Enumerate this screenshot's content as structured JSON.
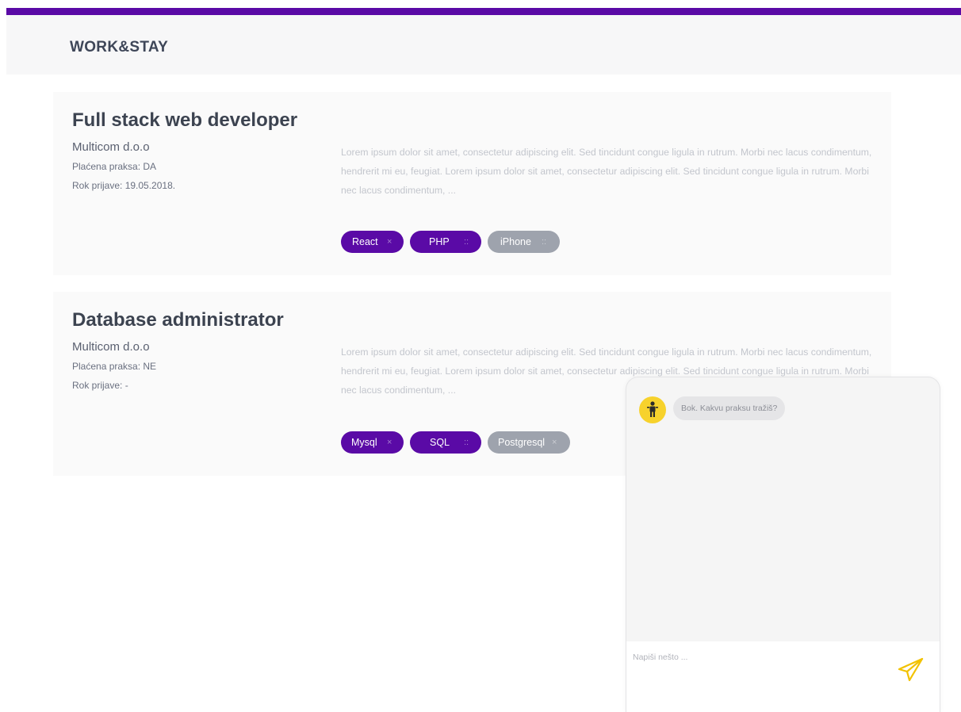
{
  "header": {
    "brand": "WORK&STAY"
  },
  "jobs": [
    {
      "title": "Full stack web developer",
      "company": "Multicom d.o.o",
      "paid": "Plaćena praksa: DA",
      "deadline": "Rok prijave: 19.05.2018.",
      "description": "Lorem ipsum dolor sit amet, consectetur adipiscing elit. Sed tincidunt congue ligula in rutrum. Morbi nec lacus condimentum, hendrerit mi eu, feugiat. Lorem ipsum dolor sit amet, consectetur adipiscing elit. Sed tincidunt congue ligula in rutrum. Morbi nec lacus condimentum, ...",
      "tags": [
        {
          "label": "React",
          "active": true,
          "x": "×"
        },
        {
          "label": "PHP",
          "active": true,
          "x": "::"
        },
        {
          "label": "iPhone",
          "active": false,
          "x": "::"
        }
      ]
    },
    {
      "title": "Database administrator",
      "company": "Multicom d.o.o",
      "paid": "Plaćena praksa: NE",
      "deadline": "Rok prijave: -",
      "description": "Lorem ipsum dolor sit amet, consectetur adipiscing elit. Sed tincidunt congue ligula in rutrum. Morbi nec lacus condimentum, hendrerit mi eu, feugiat. Lorem ipsum dolor sit amet, consectetur adipiscing elit. Sed tincidunt congue ligula in rutrum. Morbi nec lacus condimentum, ...",
      "tags": [
        {
          "label": "Mysql",
          "active": true,
          "x": "×"
        },
        {
          "label": "SQL",
          "active": true,
          "x": "::"
        },
        {
          "label": "Postgresql",
          "active": false,
          "x": "×"
        }
      ]
    }
  ],
  "chat": {
    "bot_icon": "person-icon",
    "bot_message": "Bok. Kakvu praksu tražiš?",
    "input_placeholder": "Napiši nešto ...",
    "send_icon": "paper-plane-icon"
  },
  "colors": {
    "accent": "#5a0aa6",
    "tag_inactive": "#9ea3ad",
    "bot_avatar": "#f7d22c",
    "send_icon": "#f2c200"
  }
}
